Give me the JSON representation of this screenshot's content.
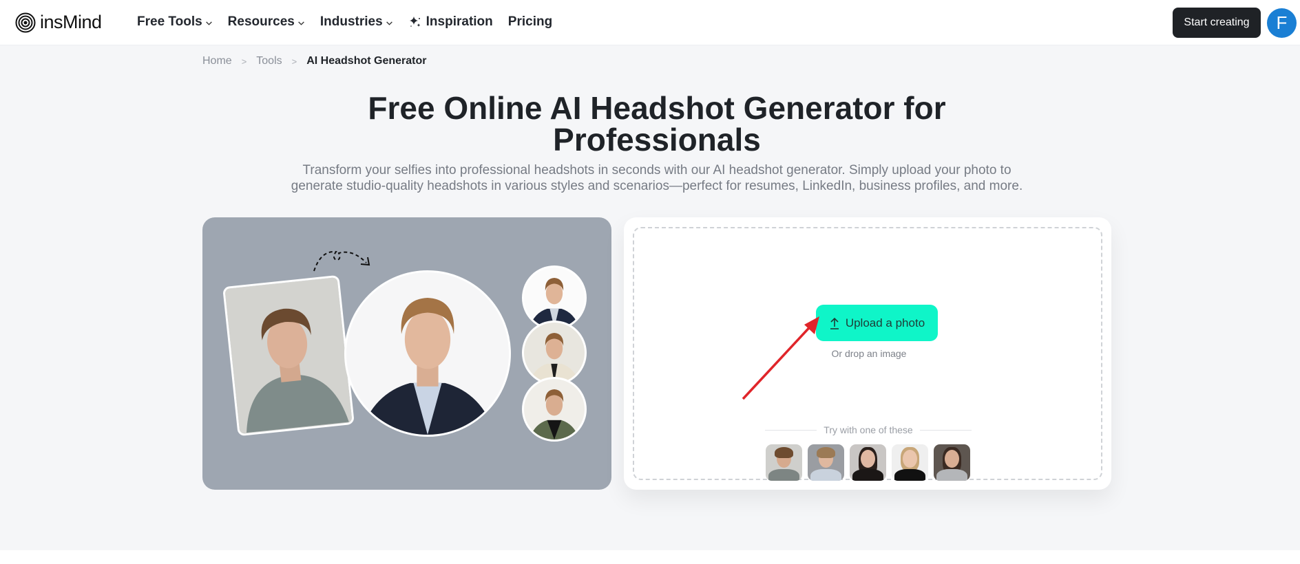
{
  "nav": {
    "brand": "insMind",
    "items": [
      {
        "label": "Free Tools",
        "has_dropdown": true,
        "icon": null
      },
      {
        "label": "Resources",
        "has_dropdown": true,
        "icon": null
      },
      {
        "label": "Industries",
        "has_dropdown": true,
        "icon": null
      },
      {
        "label": "Inspiration",
        "has_dropdown": false,
        "icon": "sparkle-icon"
      },
      {
        "label": "Pricing",
        "has_dropdown": false,
        "icon": null
      }
    ],
    "cta_label": "Start creating",
    "avatar_initial": "F",
    "avatar_color": "#1a7fd4"
  },
  "breadcrumb": {
    "items": [
      "Home",
      "Tools",
      "AI Headshot Generator"
    ],
    "separator": ">"
  },
  "hero": {
    "title_line1": "Free Online AI Headshot Generator for",
    "title_line2": "Professionals",
    "subtitle": "Transform your selfies into professional headshots in seconds with our AI headshot generator. Simply upload your photo to generate studio-quality headshots in various styles and scenarios—perfect for resumes, LinkedIn, business profiles, and more."
  },
  "showcase": {
    "original_label": "original selfie",
    "result_label": "generated headshot",
    "variants": [
      "navy suit",
      "beige blazer",
      "olive jacket"
    ]
  },
  "upload": {
    "button_label": "Upload a photo",
    "drop_text": "Or drop an image",
    "try_label": "Try with one of these",
    "accent_color": "#0ff5c8",
    "samples": [
      {
        "name": "sample-man-curly-hair"
      },
      {
        "name": "sample-man-light-shirt"
      },
      {
        "name": "sample-woman-dark-hair"
      },
      {
        "name": "sample-woman-blonde"
      },
      {
        "name": "sample-woman-brunette"
      }
    ]
  }
}
